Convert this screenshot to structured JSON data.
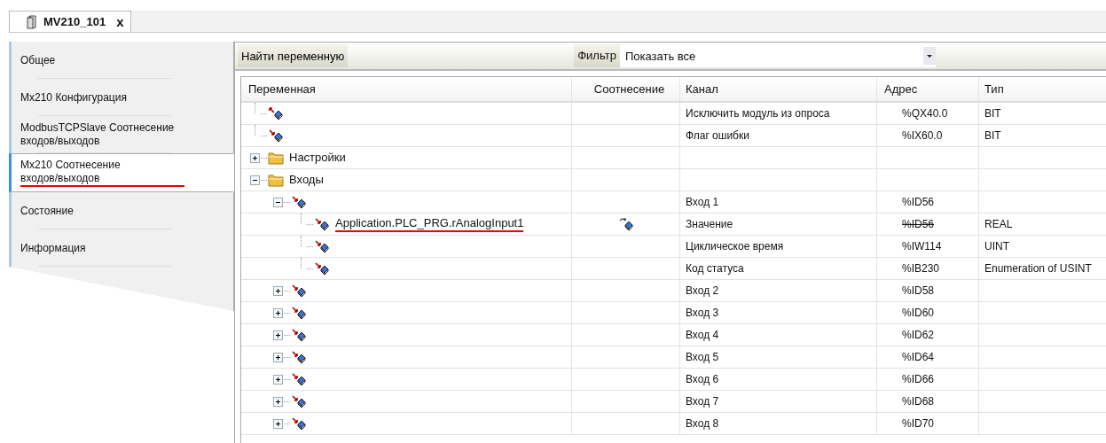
{
  "editor_tab": {
    "title": "MV210_101",
    "close": "x"
  },
  "sidebar": {
    "items": [
      {
        "label": "Общее",
        "selected": false
      },
      {
        "label": "Mx210 Конфигурация",
        "selected": false
      },
      {
        "label": "ModbusTCPSlave Соотнесение входов/выходов",
        "selected": false
      },
      {
        "label": "Mx210 Соотнесение входов/выходов",
        "selected": true,
        "underlined": true
      },
      {
        "label": "Состояние",
        "selected": false
      },
      {
        "label": "Информация",
        "selected": false
      }
    ]
  },
  "toolbar": {
    "find_button": "Найти переменную",
    "filter_label": "Фильтр",
    "filter_value": "Показать все"
  },
  "table": {
    "columns": [
      "Переменная",
      "Соотнесение",
      "Канал",
      "Адрес",
      "Тип"
    ],
    "rows": [
      {
        "kind": "output",
        "channel": "Исключить модуль из опроса",
        "address": "%QX40.0",
        "type": "BIT"
      },
      {
        "kind": "input",
        "channel": "Флаг ошибки",
        "address": "%IX60.0",
        "type": "BIT"
      },
      {
        "kind": "folder",
        "variable": "Настройки",
        "expanded": false
      },
      {
        "kind": "folder",
        "variable": "Входы",
        "expanded": true,
        "children": [
          {
            "kind": "input",
            "channel": "Вход 1",
            "address": "%ID56",
            "expanded": true,
            "children": [
              {
                "kind": "input",
                "variable": "Application.PLC_PRG.rAnalogInput1",
                "underlined": true,
                "mapped": true,
                "channel": "Значение",
                "address": "%ID56",
                "address_struck": true,
                "type": "REAL"
              },
              {
                "kind": "input",
                "channel": "Циклическое время",
                "address": "%IW114",
                "type": "UINT"
              },
              {
                "kind": "input",
                "channel": "Код статуса",
                "address": "%IB230",
                "type": "Enumeration of USINT"
              }
            ]
          },
          {
            "kind": "input",
            "channel": "Вход 2",
            "address": "%ID58",
            "expanded": false
          },
          {
            "kind": "input",
            "channel": "Вход 3",
            "address": "%ID60",
            "expanded": false
          },
          {
            "kind": "input",
            "channel": "Вход 4",
            "address": "%ID62",
            "expanded": false
          },
          {
            "kind": "input",
            "channel": "Вход 5",
            "address": "%ID64",
            "expanded": false
          },
          {
            "kind": "input",
            "channel": "Вход 6",
            "address": "%ID66",
            "expanded": false
          },
          {
            "kind": "input",
            "channel": "Вход 7",
            "address": "%ID68",
            "expanded": false
          },
          {
            "kind": "input",
            "channel": "Вход 8",
            "address": "%ID70",
            "expanded": false
          }
        ]
      }
    ]
  }
}
